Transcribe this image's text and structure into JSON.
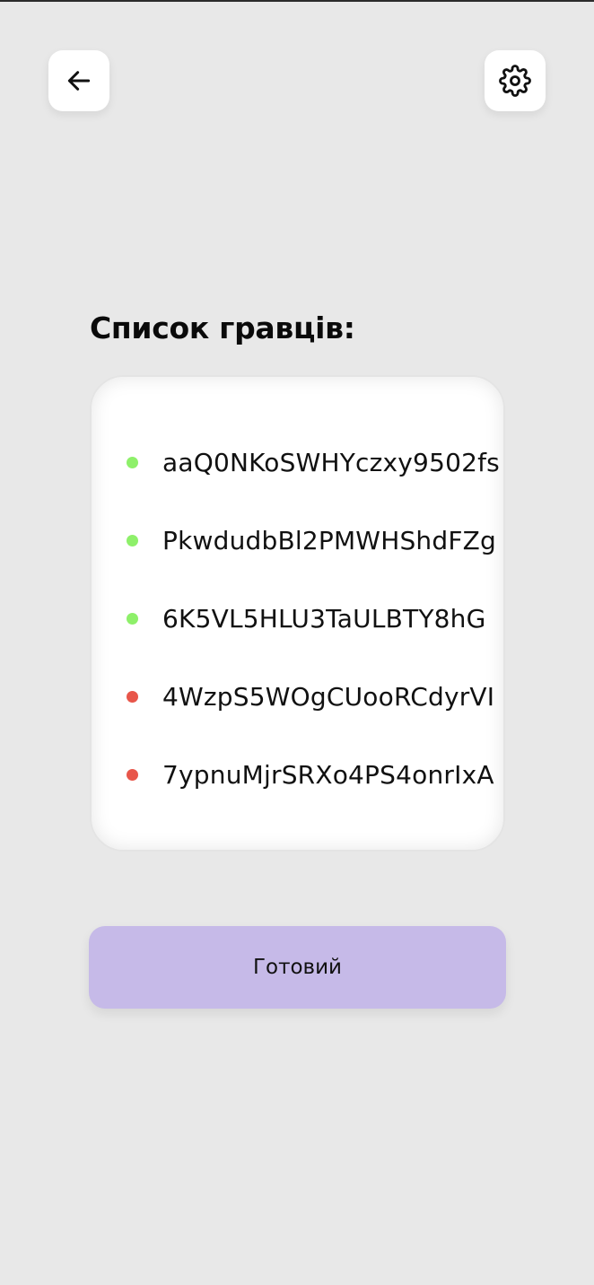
{
  "header": {
    "back_icon": "arrow-left-icon",
    "settings_icon": "gear-icon"
  },
  "players": {
    "title": "Список гравців:",
    "items": [
      {
        "name": "aaQ0NKoSWHYczxy9502fs",
        "status": "online",
        "status_color": "#8ef06a"
      },
      {
        "name": "PkwdudbBl2PMWHShdFZg",
        "status": "online",
        "status_color": "#8ef06a"
      },
      {
        "name": "6K5VL5HLU3TaULBTY8hG",
        "status": "online",
        "status_color": "#8ef06a"
      },
      {
        "name": "4WzpS5WOgCUooRCdyrVI",
        "status": "offline",
        "status_color": "#e8564a"
      },
      {
        "name": "7ypnuMjrSRXo4PS4onrIxA",
        "status": "offline",
        "status_color": "#e8564a"
      }
    ]
  },
  "actions": {
    "done_label": "Готовий",
    "done_color": "#c6bae8"
  }
}
